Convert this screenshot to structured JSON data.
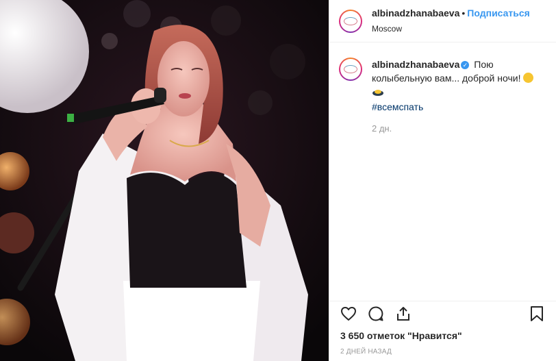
{
  "post": {
    "image_alt": "",
    "username": "albinadzhanabaeva",
    "follow_label": "Подписаться",
    "separator": "•",
    "location": "Moscow"
  },
  "caption": {
    "username": "albinadzhanabaeva",
    "verified_mark": "✓",
    "text": "Пою колыбельную вам... доброй ночи!",
    "hashtag": "#всемспать",
    "time": "2 дн."
  },
  "actions": {
    "like_icon": "heart-icon",
    "comment_icon": "comment-icon",
    "share_icon": "share-icon",
    "save_icon": "bookmark-icon"
  },
  "likes": "3 650 отметок \"Нравится\"",
  "posted_ago": "2 ДНЕЙ НАЗАД",
  "colors": {
    "link": "#3897f0",
    "hashtag": "#003569",
    "muted": "#999999"
  }
}
